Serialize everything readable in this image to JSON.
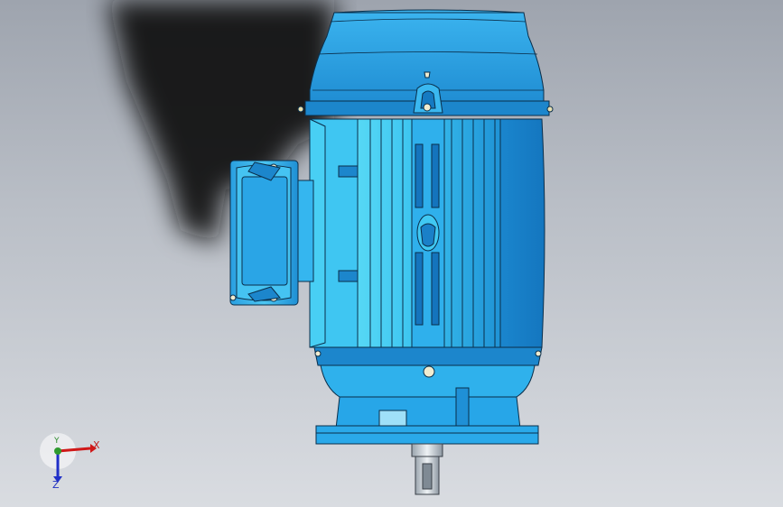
{
  "viewport": {
    "model": "motor-assembly",
    "view": "front",
    "background_top": "#9ea4ae",
    "background_bottom": "#d9dce1",
    "body_color": "#29a3e6",
    "body_light": "#5fd0f5",
    "body_dark": "#0f6fb3",
    "outline_color": "#0a2e4a"
  },
  "triad": {
    "x_label": "X",
    "y_label": "Y",
    "z_label": "Z",
    "x_color": "#d01818",
    "y_color": "#2e9a2e",
    "z_color": "#1f2fc8"
  }
}
